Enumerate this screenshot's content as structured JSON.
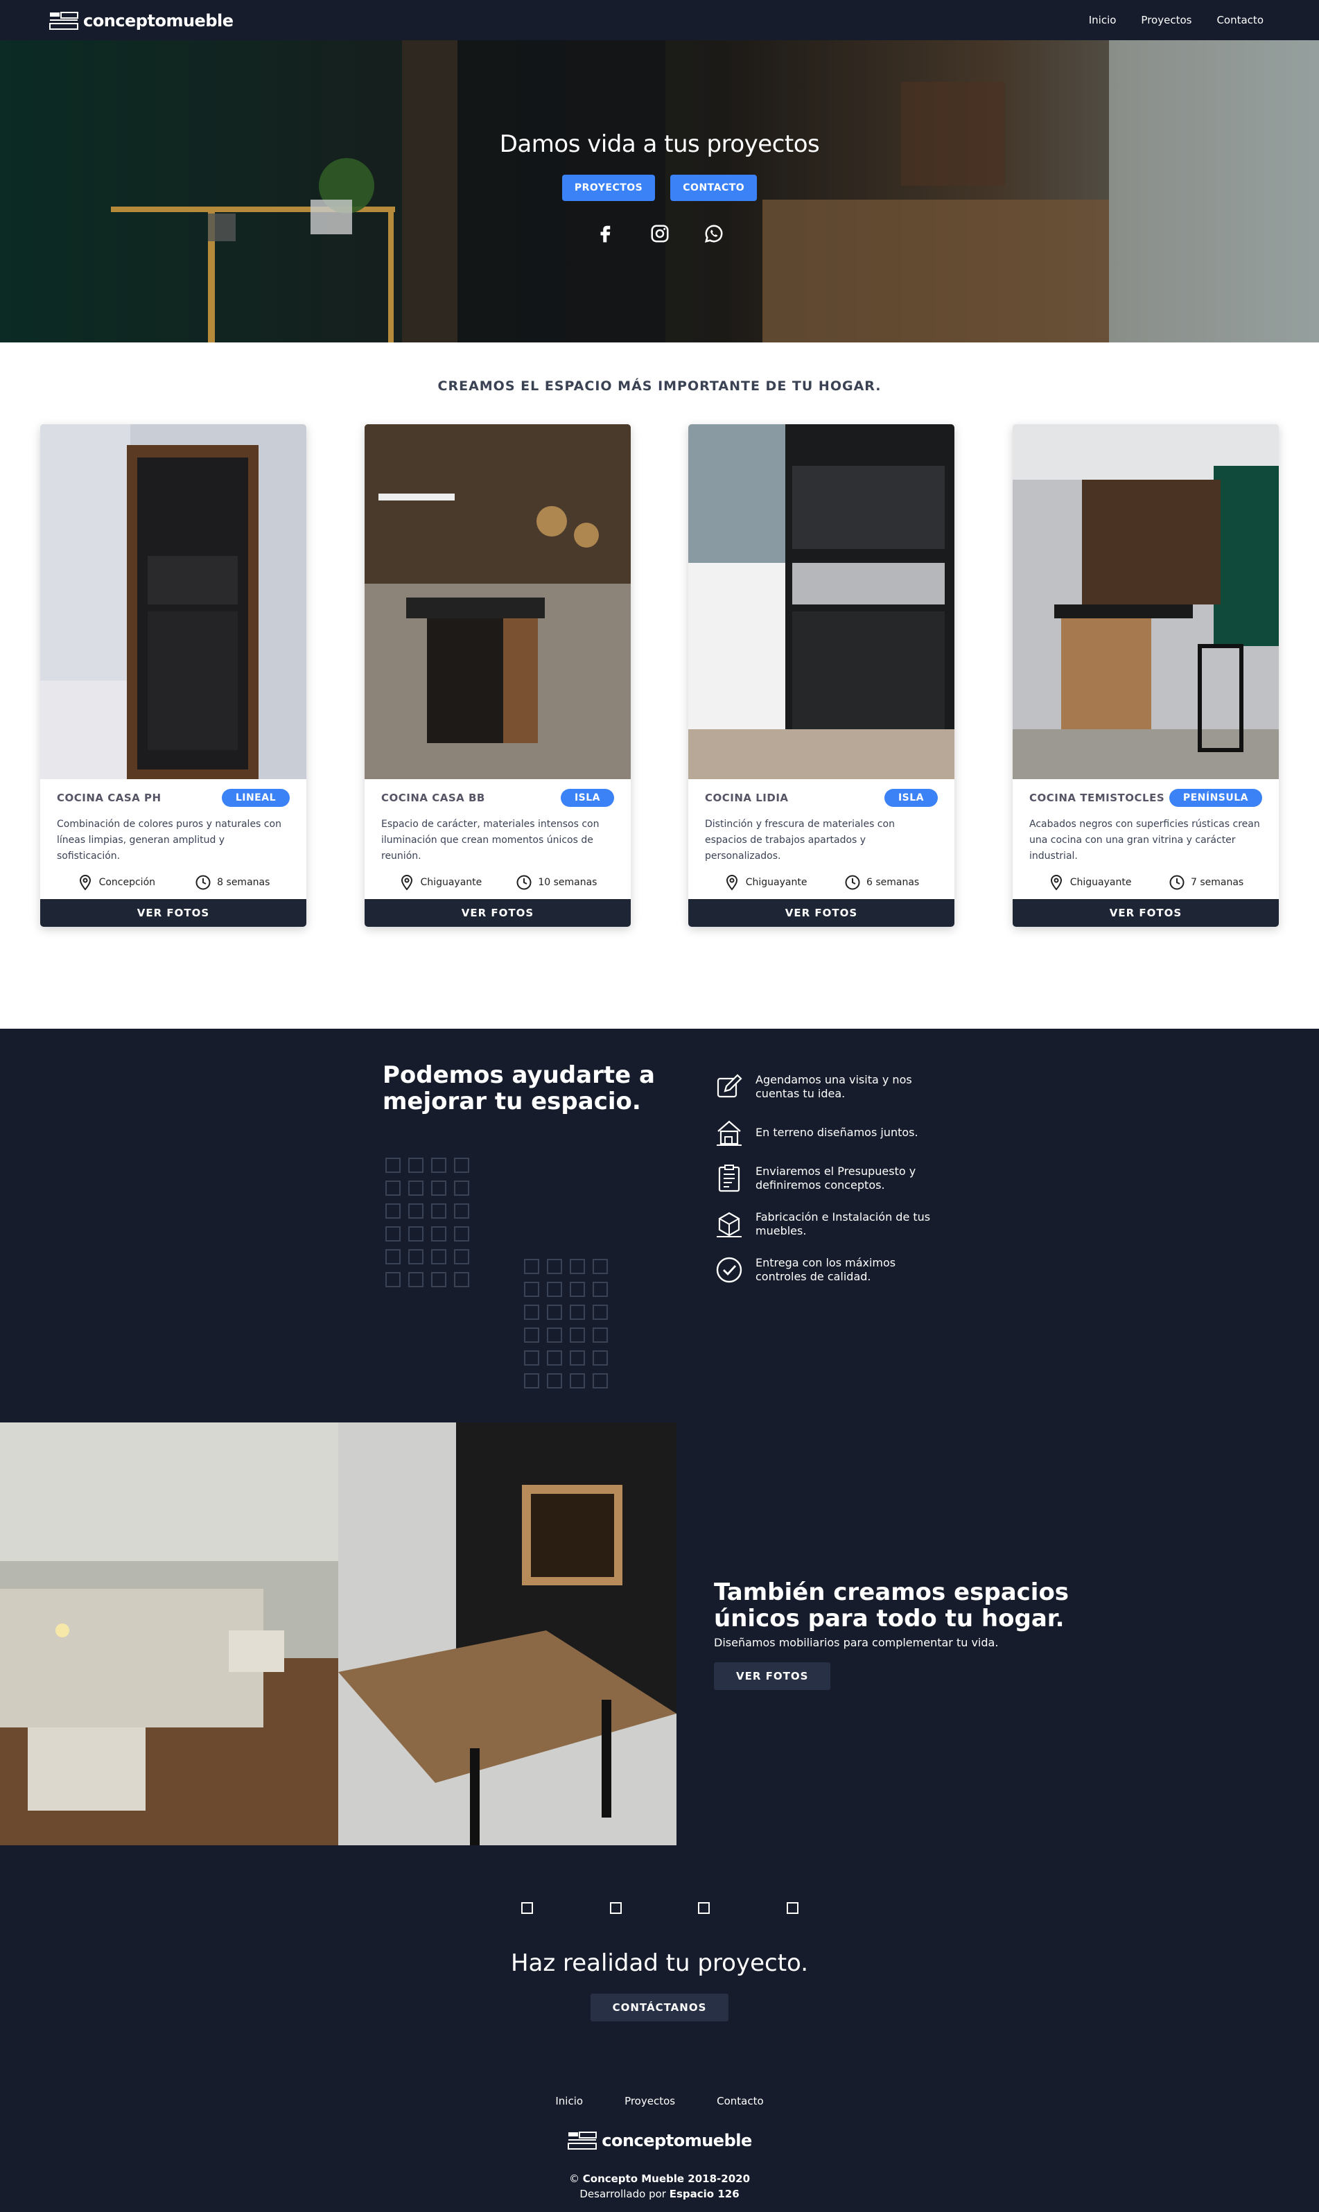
{
  "nav": {
    "logo": "conceptomueble",
    "links": [
      "Inicio",
      "Proyectos",
      "Contacto"
    ]
  },
  "hero": {
    "title": "Damos vida a tus proyectos",
    "btn_projects": "PROYECTOS",
    "btn_contact": "CONTACTO",
    "social": [
      "facebook-icon",
      "instagram-icon",
      "whatsapp-icon"
    ]
  },
  "tagline": "CREAMOS EL ESPACIO MÁS IMPORTANTE DE TU HOGAR.",
  "cards": [
    {
      "title": "COCINA CASA PH",
      "badge": "LINEAL",
      "desc": "Combinación de colores puros y naturales con líneas limpias, generan amplitud y sofisticación.",
      "location": "Concepción",
      "time": "8 semanas",
      "button": "VER FOTOS"
    },
    {
      "title": "COCINA CASA BB",
      "badge": "ISLA",
      "desc": "Espacio de carácter, materiales intensos con iluminación que crean momentos únicos de reunión.",
      "location": "Chiguayante",
      "time": "10 semanas",
      "button": "VER FOTOS"
    },
    {
      "title": "COCINA LIDIA",
      "badge": "ISLA",
      "desc": "Distinción y frescura de materiales con espacios de trabajos apartados y personalizados.",
      "location": "Chiguayante",
      "time": "6 semanas",
      "button": "VER FOTOS"
    },
    {
      "title": "COCINA TEMISTOCLES",
      "badge": "PENÍNSULA",
      "desc": "Acabados negros con superficies rústicas crean una cocina con una gran vitrina y carácter industrial.",
      "location": "Chiguayante",
      "time": "7 semanas",
      "button": "VER FOTOS"
    }
  ],
  "process": {
    "title_line1": "Podemos ayudarte a",
    "title_line2": "mejorar tu espacio.",
    "steps": [
      "Agendamos una visita y nos cuentas tu idea.",
      "En terreno diseñamos juntos.",
      "Enviaremos el Presupuesto y definiremos conceptos.",
      "Fabricación e Instalación de tus muebles.",
      "Entrega con los máximos controles de calidad."
    ]
  },
  "spaces": {
    "title_line1": "También creamos espacios",
    "title_line2": "únicos para todo tu hogar.",
    "subtitle": "Diseñamos mobiliarios para complementar tu vida.",
    "button": "VER FOTOS"
  },
  "cta": {
    "title": "Haz realidad tu proyecto.",
    "button": "CONTÁCTANOS"
  },
  "footer": {
    "links": [
      "Inicio",
      "Proyectos",
      "Contacto"
    ],
    "logo": "conceptomueble",
    "copy_prefix": "© ",
    "copy_brand": "Concepto Mueble 2018-2020",
    "dev_prefix": "Desarrollado por ",
    "dev_brand": "Espacio 126"
  },
  "colors": {
    "accent": "#3b82f6",
    "dark": "#161c2b",
    "button_dark": "#1e2535"
  }
}
